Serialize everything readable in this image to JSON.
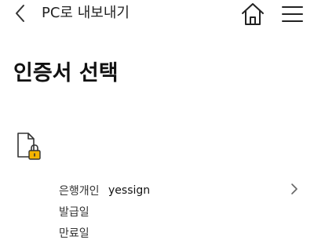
{
  "header": {
    "title": "PC로 내보내기",
    "back_icon": "chevron-left-icon",
    "home_icon": "home-icon",
    "menu_icon": "hamburger-menu-icon"
  },
  "page": {
    "title": "인증서 선택"
  },
  "certificate": {
    "icon": "locked-document-icon",
    "lock_color": "#f4b400",
    "fields": [
      {
        "label": "은행개인",
        "value": "yessign"
      },
      {
        "label": "발급일",
        "value": ""
      },
      {
        "label": "만료일",
        "value": ""
      }
    ],
    "chevron_icon": "chevron-right-icon"
  }
}
